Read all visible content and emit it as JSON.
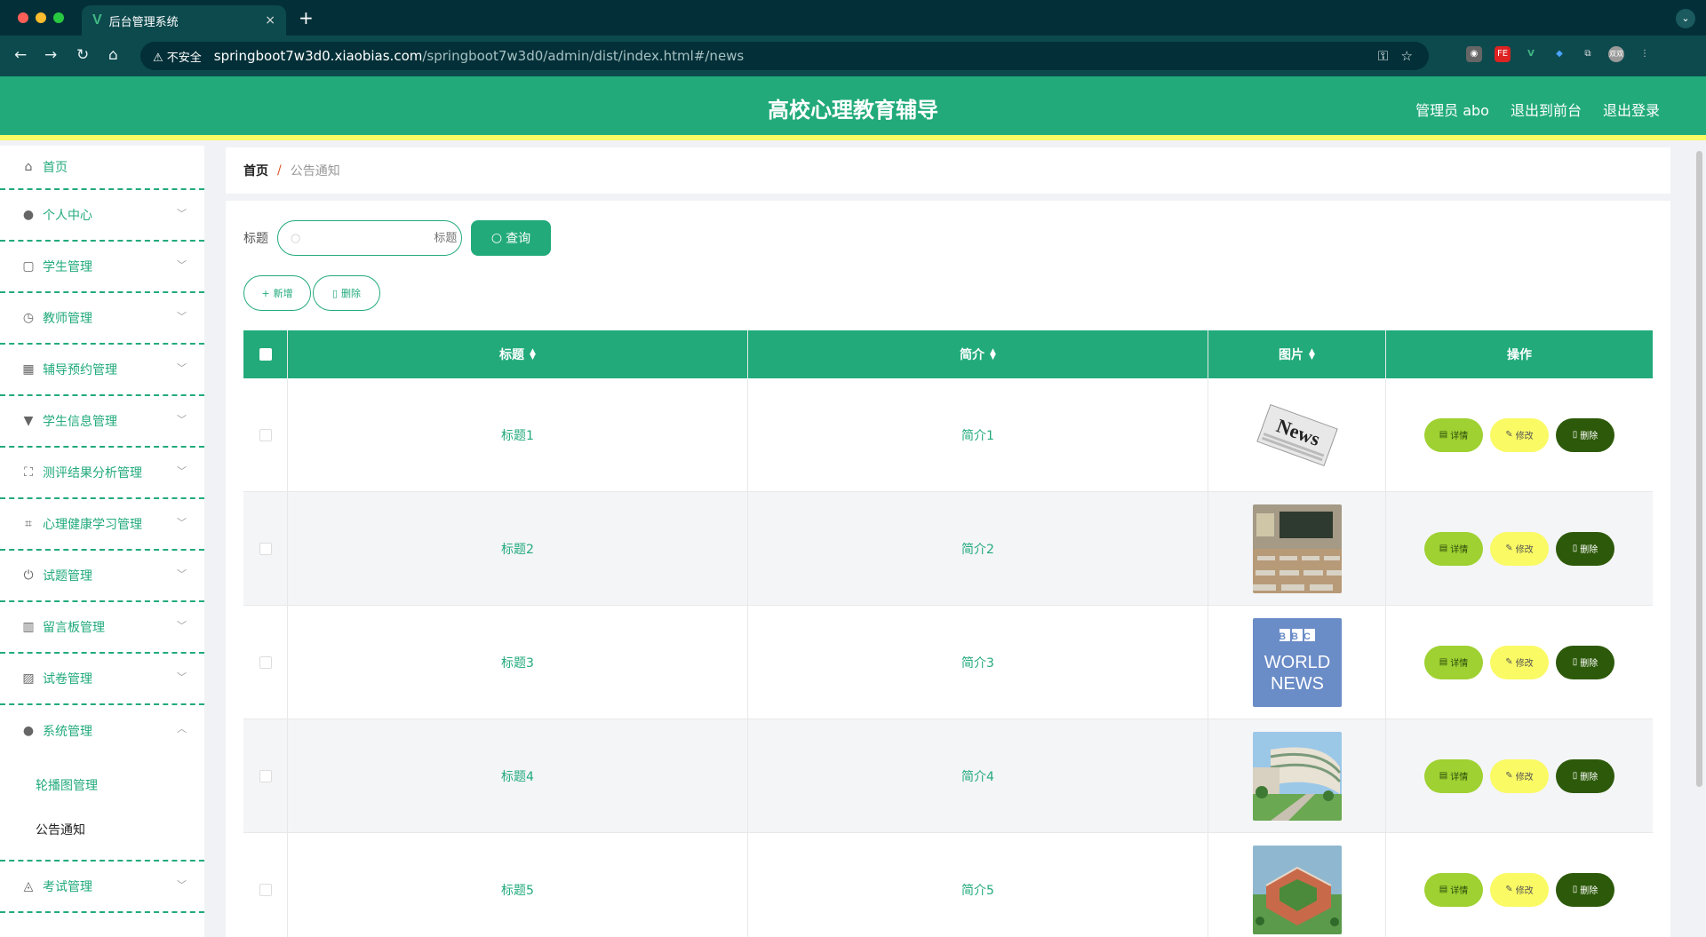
{
  "browser": {
    "tab_title": "后台管理系统",
    "tab_logo": "V",
    "new_tab": "+",
    "close": "×",
    "insecure_label": "⚠ 不安全",
    "url_host": "springboot7w3d0.xiaobias.com",
    "url_path": "/springboot7w3d0/admin/dist/index.html#/news",
    "profile": "双双"
  },
  "header": {
    "title": "高校心理教育辅导",
    "admin_label": "管理员 abo",
    "to_front": "退出到前台",
    "logout": "退出登录"
  },
  "sidebar": {
    "items": [
      {
        "label": "首页",
        "icon": "home-icon",
        "glyph": "⌂"
      },
      {
        "label": "个人中心",
        "icon": "user-icon",
        "glyph": "●"
      },
      {
        "label": "学生管理",
        "icon": "copy-icon",
        "glyph": "▢"
      },
      {
        "label": "教师管理",
        "icon": "clock-icon",
        "glyph": "◷"
      },
      {
        "label": "辅导预约管理",
        "icon": "grid-icon",
        "glyph": "▦"
      },
      {
        "label": "学生信息管理",
        "icon": "brush-icon",
        "glyph": "▼"
      },
      {
        "label": "测评结果分析管理",
        "icon": "fullscreen-icon",
        "glyph": "⛶"
      },
      {
        "label": "心理健康学习管理",
        "icon": "crop-icon",
        "glyph": "⌗"
      },
      {
        "label": "试题管理",
        "icon": "power-icon",
        "glyph": "⏻"
      },
      {
        "label": "留言板管理",
        "icon": "library-icon",
        "glyph": "▥"
      },
      {
        "label": "试卷管理",
        "icon": "chart-icon",
        "glyph": "▨"
      },
      {
        "label": "系统管理",
        "icon": "user-icon",
        "glyph": "●"
      },
      {
        "label": "考试管理",
        "icon": "bell-off-icon",
        "glyph": "◬"
      }
    ],
    "sub_items": [
      {
        "label": "轮播图管理"
      },
      {
        "label": "公告通知"
      }
    ]
  },
  "breadcrumb": {
    "home": "首页",
    "sep": "/",
    "current": "公告通知"
  },
  "search": {
    "label": "标题",
    "placeholder": "标题",
    "button": "查询"
  },
  "actions": {
    "add": "新增",
    "delete": "删除"
  },
  "table": {
    "columns": [
      "标题",
      "简介",
      "图片",
      "操作"
    ],
    "rows": [
      {
        "title": "标题1",
        "intro": "简介1",
        "image": "news-newspaper"
      },
      {
        "title": "标题2",
        "intro": "简介2",
        "image": "classroom"
      },
      {
        "title": "标题3",
        "intro": "简介3",
        "image": "bbc-world-news"
      },
      {
        "title": "标题4",
        "intro": "简介4",
        "image": "campus-building"
      },
      {
        "title": "标题5",
        "intro": "简介5",
        "image": "campus-aerial"
      }
    ],
    "ops": {
      "detail": "详情",
      "edit": "修改",
      "delete": "删除"
    }
  },
  "images": {
    "bbc_line1": "BBC",
    "bbc_line2": "WORLD",
    "bbc_line3": "NEWS",
    "news_word": "News"
  },
  "colors": {
    "primary": "#22aa7b",
    "accent_yellow": "#fafa64",
    "detail_green": "#9ed131",
    "delete_dark": "#2d5a0a"
  }
}
